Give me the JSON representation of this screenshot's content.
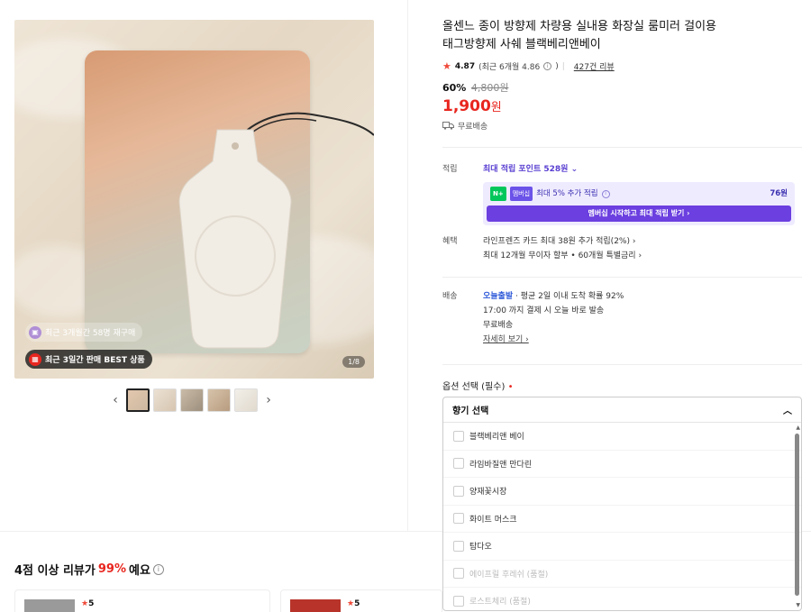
{
  "product": {
    "title_line1": "올센느 종이 방향제 차량용 실내용 화장실 룸미러 걸이용",
    "title_line2": "태그방향제 사쉐 블랙베리앤베이",
    "rating": "4.87",
    "rating_recent": "(최근 6개월 4.86",
    "review_count": "427건 리뷰",
    "discount_rate": "60%",
    "original_price": "4,800원",
    "price": "1,900",
    "price_unit": "원",
    "shipping": "무료배송"
  },
  "gallery": {
    "badge_restock": "최근 3개월간 58명 재구매",
    "badge_best": "최근 3일간 판매 BEST 상품",
    "counter": "1/8",
    "prev_label": "‹",
    "next_label": "›"
  },
  "points": {
    "label": "적립",
    "max_points": "최대 적립 포인트 528원",
    "np_chip1": "N+",
    "np_chip2": "멤버십",
    "np_text": "최대 5% 추가 적립",
    "np_amount": "76원",
    "np_button": "멤버십 시작하고 최대 적립 받기 ›"
  },
  "benefit": {
    "label": "혜택",
    "line1": "라인프렌즈 카드 최대 38원 추가 적립(2%) ›",
    "line2": "최대 12개월 무이자 할부 • 60개월 특별금리 ›"
  },
  "delivery": {
    "label": "배송",
    "fast": "오늘출발",
    "line1_rest": "· 평균 2일 이내 도착 확률 92%",
    "line2": "17:00 까지 결제 시 오늘 바로 발송",
    "line3": "무료배송",
    "detail_link": "자세히 보기 ›"
  },
  "options": {
    "label": "옵션 선택 (필수)",
    "required_mark": "•",
    "dropdown_title": "향기 선택",
    "items": [
      {
        "label": "블랙베리앤 베이",
        "disabled": false
      },
      {
        "label": "라임바질앤 만다린",
        "disabled": false
      },
      {
        "label": "양재꽃시장",
        "disabled": false
      },
      {
        "label": "화이트 머스크",
        "disabled": false
      },
      {
        "label": "탐다오",
        "disabled": false
      },
      {
        "label": "에이프릴 후레쉬 (품절)",
        "disabled": true
      },
      {
        "label": "로스트체리 (품절)",
        "disabled": true
      }
    ]
  },
  "reviews": {
    "heading_pre": "4점 이상 리뷰가 ",
    "heading_pct": "99%",
    "heading_post": "예요",
    "card1_rating": "5",
    "card2_rating": "5"
  },
  "colors": {
    "accent_red": "#e8261f",
    "naver_purple": "#6b3fe0",
    "star": "#f04a3a"
  }
}
